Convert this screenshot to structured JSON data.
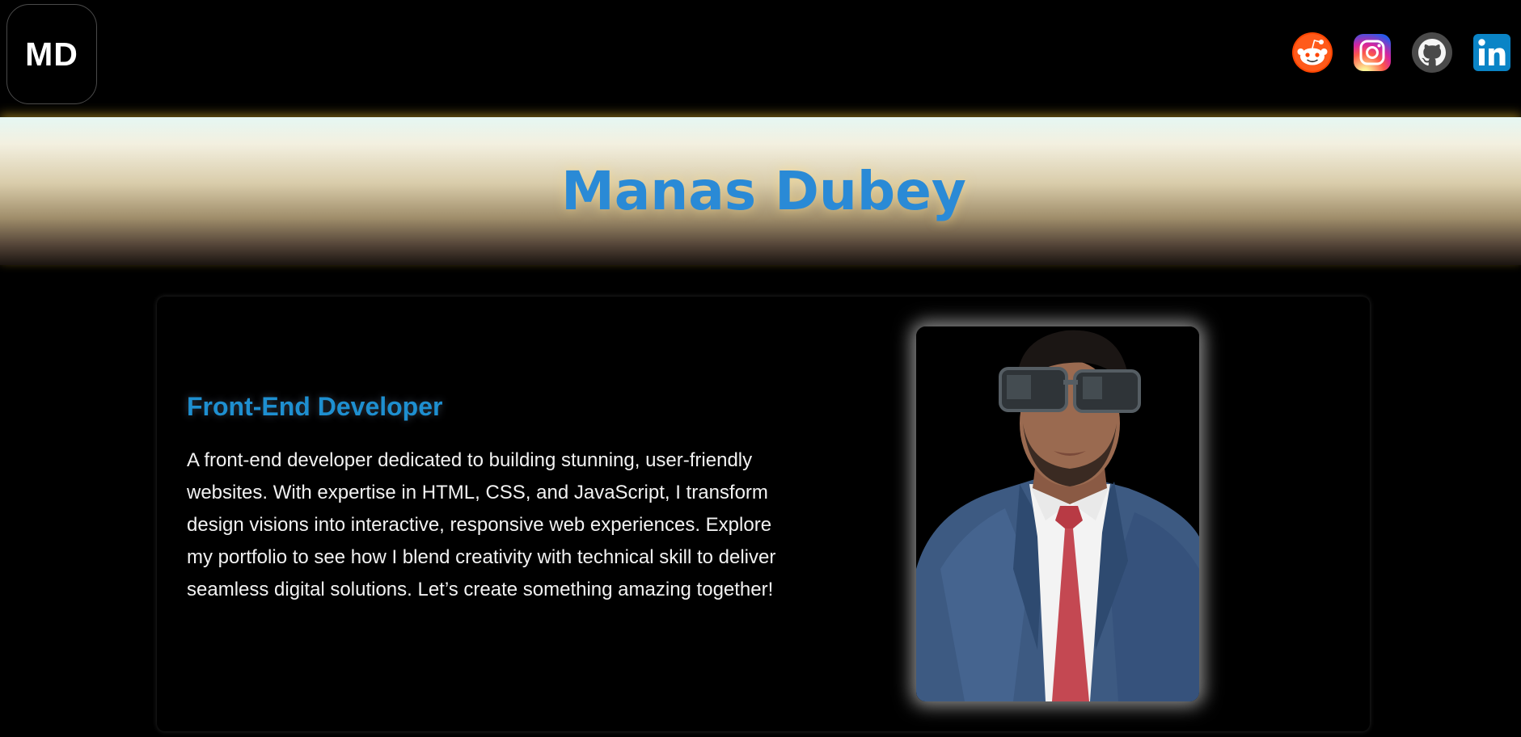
{
  "header": {
    "logo_text": "MD",
    "socials": [
      {
        "name": "Reddit",
        "icon": "reddit-icon",
        "color": "#ff4500"
      },
      {
        "name": "Instagram",
        "icon": "instagram-icon",
        "color": "#d6249f"
      },
      {
        "name": "GitHub",
        "icon": "github-icon",
        "color": "#5b5b5b"
      },
      {
        "name": "LinkedIn",
        "icon": "linkedin-icon",
        "color": "#0a84c6"
      }
    ]
  },
  "hero": {
    "name": "Manas Dubey"
  },
  "about": {
    "role": "Front-End Developer",
    "bio": "A front-end developer dedicated to building stunning, user-friendly websites. With expertise in HTML, CSS, and JavaScript, I transform design visions into interactive, responsive web experiences. Explore my portfolio to see how I blend creativity with technical skill to deliver seamless digital solutions. Let’s create something amazing together!",
    "photo_label": "profile-photo"
  },
  "colors": {
    "accent_blue": "#2a8ad6",
    "role_blue": "#1e8fd0",
    "background": "#000000"
  }
}
